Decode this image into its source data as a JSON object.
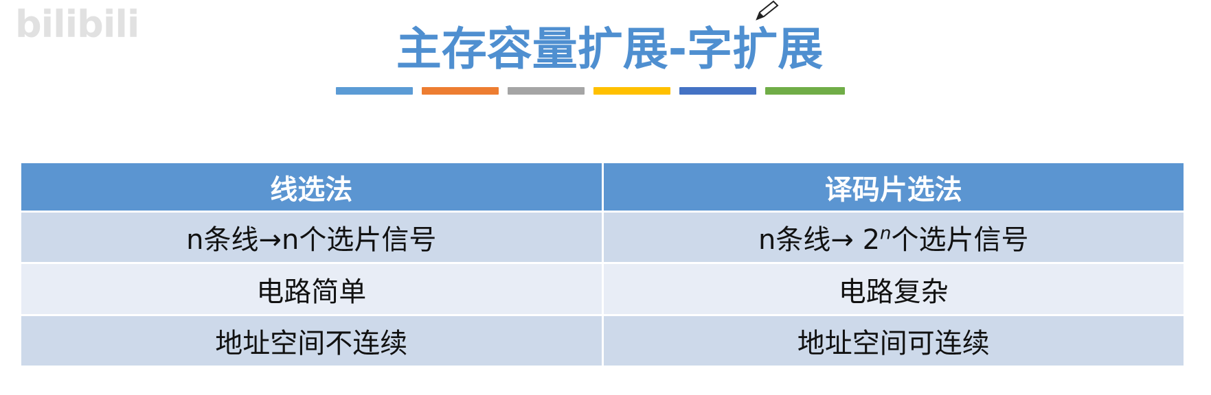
{
  "watermark": {
    "text": "bilibili"
  },
  "title": "主存容量扩展-字扩展",
  "stripes": [
    "#5b9bd5",
    "#ed7d31",
    "#a5a5a5",
    "#ffc000",
    "#4472c4",
    "#70ad47"
  ],
  "colors": {
    "title": "#4f8fd0",
    "header_bg": "#5b95d1",
    "row_odd_bg": "#cdd9ea",
    "row_even_bg": "#e8edf6"
  },
  "table": {
    "headers": [
      "线选法",
      "译码片选法"
    ],
    "rows": [
      {
        "left": "n条线→n个选片信号",
        "right_prefix": "n条线→ 2",
        "right_sup": "n",
        "right_suffix": "个选片信号"
      },
      {
        "left": "电路简单",
        "right": "电路复杂"
      },
      {
        "left": "地址空间不连续",
        "right": "地址空间可连续"
      }
    ]
  }
}
